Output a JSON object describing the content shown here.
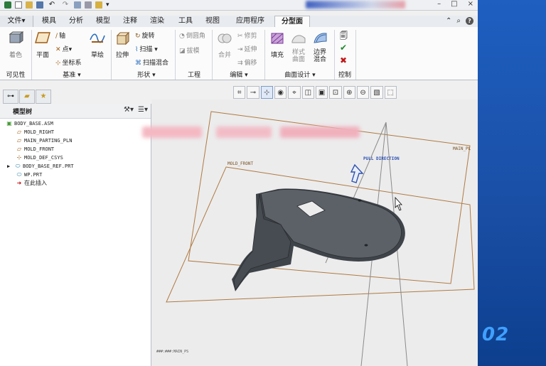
{
  "menu_tabs": [
    {
      "label": "文件",
      "dropdown": "▾",
      "active": false
    },
    {
      "label": "模具",
      "active": false
    },
    {
      "label": "分析",
      "active": false
    },
    {
      "label": "模型",
      "active": false
    },
    {
      "label": "注释",
      "active": false
    },
    {
      "label": "渲染",
      "active": false
    },
    {
      "label": "工具",
      "active": false
    },
    {
      "label": "视图",
      "active": false
    },
    {
      "label": "应用程序",
      "active": false
    },
    {
      "label": "分型面",
      "active": true
    }
  ],
  "window_controls": {
    "minimize": "–",
    "restore": "□",
    "close": "×"
  },
  "ribbon": {
    "visibility": {
      "paint": "着色",
      "group_label": "可见性"
    },
    "datum": {
      "plane": "平面",
      "axis": "轴",
      "point": "点",
      "csys": "坐标系",
      "sketch": "草绘",
      "group_label": "基准"
    },
    "shapes": {
      "extrude": "拉伸",
      "revolve": "旋转",
      "sweep": "扫描",
      "swept_blend": "扫描混合",
      "group_label": "形状"
    },
    "engineering": {
      "round": "倒圆角",
      "draft": "拔模",
      "group_label": "工程"
    },
    "editing": {
      "merge": "合并",
      "trim": "修剪",
      "extend": "延伸",
      "offset": "偏移",
      "group_label": "编辑"
    },
    "surface_design": {
      "fill": "填充",
      "style_surface": "样式\n曲面",
      "boundary_blend": "边界\n混合",
      "group_label": "曲面设计"
    },
    "control": {
      "group_label": "控制"
    },
    "dropdown": "▾"
  },
  "model_tree": {
    "header": "模型树",
    "items": [
      {
        "label": "BODY_BASE.ASM",
        "icon": "assembly-icon",
        "indent": 0
      },
      {
        "label": "MOLD_RIGHT",
        "icon": "datum-plane-icon",
        "indent": 1
      },
      {
        "label": "MAIN_PARTING_PLN",
        "icon": "datum-plane-icon",
        "indent": 1
      },
      {
        "label": "MOLD_FRONT",
        "icon": "datum-plane-icon",
        "indent": 1
      },
      {
        "label": "MOLD_DEF_CSYS",
        "icon": "csys-icon",
        "indent": 1
      },
      {
        "label": "BODY_BASE_REF.PRT",
        "icon": "part-icon",
        "indent": 1,
        "expandable": true
      },
      {
        "label": "WP.PRT",
        "icon": "workpiece-icon",
        "indent": 1
      },
      {
        "label": "在此插入",
        "icon": "insert-arrow-icon",
        "indent": 1
      }
    ]
  },
  "viewport": {
    "labels": {
      "mold_front": "MOLD_FRONT",
      "pull_direction": "PULL DIRECTION",
      "main_pl": "MAIN_PL",
      "bottom": "###:###:MAIN_PS"
    }
  },
  "desktop": {
    "number": "02"
  },
  "colors": {
    "accent_active_tab": "#fbfbfb",
    "datum_plane": "#b08050",
    "part": "#4a4f55",
    "pull_arrow": "#2f52b0",
    "close_red": "#c01818"
  }
}
